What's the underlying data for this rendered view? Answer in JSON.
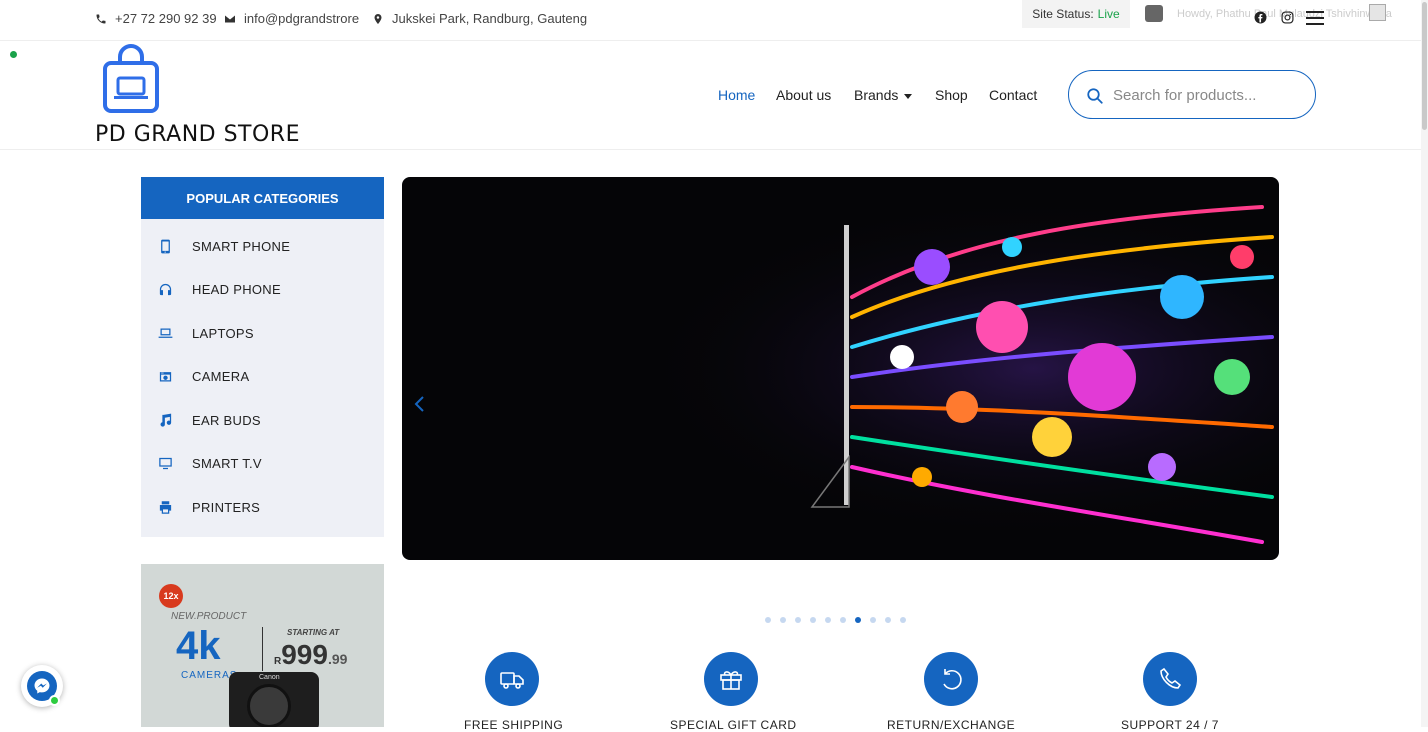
{
  "topbar": {
    "phone": "+27 72 290 92 39",
    "email": "info@pdgrandstrore",
    "address": "Jukskei Park, Randburg, Gauteng",
    "site_status_label": "Site Status:",
    "site_status_value": "Live",
    "howdy": "Howdy, Phathu Paul Mulaudzi Tshivhinwana",
    "status_color": "#1aa24a"
  },
  "brand": {
    "name": "PD GRAND STORE",
    "accent": "#1565c0"
  },
  "nav": {
    "items": [
      {
        "label": "Home"
      },
      {
        "label": "About us"
      },
      {
        "label": "Brands"
      },
      {
        "label": "Shop"
      },
      {
        "label": "Contact"
      }
    ],
    "active": "Home"
  },
  "search": {
    "placeholder": "Search for products..."
  },
  "categories": {
    "title": "POPULAR CATEGORIES",
    "items": [
      {
        "label": "SMART PHONE",
        "icon": "smartphone-icon"
      },
      {
        "label": "HEAD PHONE",
        "icon": "headphones-icon"
      },
      {
        "label": "LAPTOPS",
        "icon": "laptop-icon"
      },
      {
        "label": "CAMERA",
        "icon": "camera-icon"
      },
      {
        "label": "EAR BUDS",
        "icon": "music-note-icon"
      },
      {
        "label": "SMART T.V",
        "icon": "tv-icon"
      },
      {
        "label": "PRINTERS",
        "icon": "printer-icon"
      }
    ]
  },
  "promo": {
    "badge": "12x",
    "tag": "NEW.PRODUCT",
    "headline": "4k",
    "subline": "CAMERAS",
    "starting_label": "STARTING AT",
    "currency": "R",
    "price_main": "999",
    "price_cents": ".99",
    "camera_brand": "Canon"
  },
  "slider": {
    "dot_count": 10,
    "active_dot": 7
  },
  "features": [
    {
      "label": "FREE SHIPPING",
      "icon": "truck-icon"
    },
    {
      "label": "SPECIAL GIFT CARD",
      "icon": "gift-icon"
    },
    {
      "label": "RETURN/EXCHANGE",
      "icon": "refresh-icon"
    },
    {
      "label": "SUPPORT 24 / 7",
      "icon": "phone-icon"
    }
  ]
}
